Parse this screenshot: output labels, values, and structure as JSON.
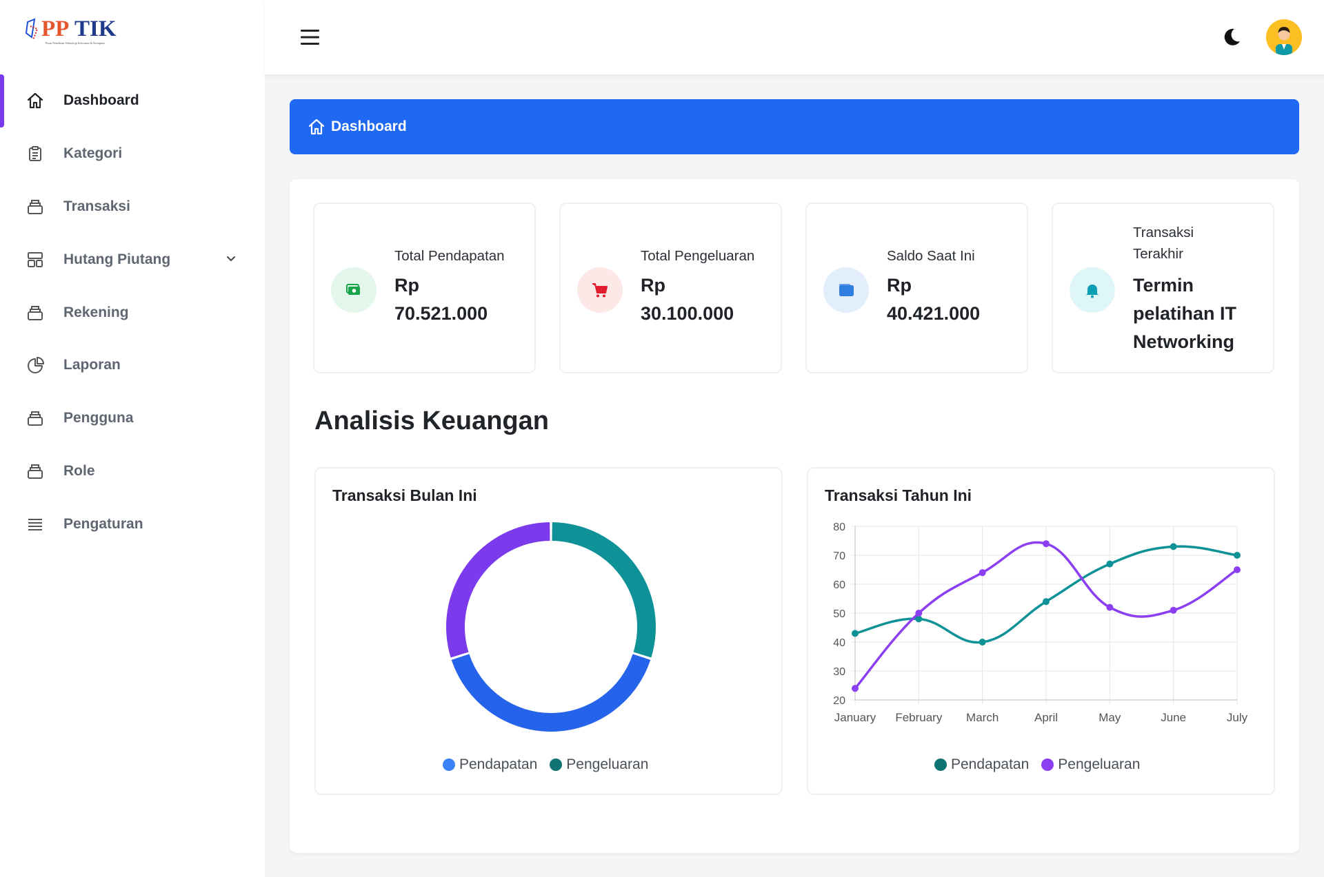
{
  "app": {
    "logo_text": "PPTIK",
    "logo_subtitle": "Pusat Penelitian Teknologi Informasi & Komputer"
  },
  "sidebar": {
    "items": [
      {
        "label": "Dashboard",
        "icon": "home-icon",
        "active": true
      },
      {
        "label": "Kategori",
        "icon": "clipboard-icon"
      },
      {
        "label": "Transaksi",
        "icon": "stack-icon"
      },
      {
        "label": "Hutang Piutang",
        "icon": "layout-icon",
        "has_submenu": true
      },
      {
        "label": "Rekening",
        "icon": "stack-icon"
      },
      {
        "label": "Laporan",
        "icon": "pie-chart-icon"
      },
      {
        "label": "Pengguna",
        "icon": "stack-icon"
      },
      {
        "label": "Role",
        "icon": "stack-icon"
      },
      {
        "label": "Pengaturan",
        "icon": "list-icon"
      }
    ]
  },
  "topbar": {
    "menu_icon": "hamburger-icon",
    "theme_icon": "moon-icon",
    "avatar_icon": "user-avatar-icon"
  },
  "breadcrumb": {
    "label": "Dashboard",
    "icon": "home-icon",
    "color": "#1f68f2"
  },
  "stats": [
    {
      "title": "Total Pendapatan",
      "value": "Rp 70.521.000",
      "icon": "money-icon",
      "icon_color": "#16a34a",
      "icon_bg": "#e3f6ec"
    },
    {
      "title": "Total Pengeluaran",
      "value": "Rp 30.100.000",
      "icon": "cart-icon",
      "icon_color": "#e11d2e",
      "icon_bg": "#fde8e8"
    },
    {
      "title": "Saldo Saat Ini",
      "value": "Rp 40.421.000",
      "icon": "wallet-icon",
      "icon_color": "#2f7de1",
      "icon_bg": "#e3eefc"
    },
    {
      "title": "Transaksi Terakhir",
      "value": "Termin pelatihan IT Networking",
      "icon": "bell-icon",
      "icon_color": "#0e9fb4",
      "icon_bg": "#dff6f9"
    }
  ],
  "section_title": "Analisis Keuangan",
  "charts": {
    "monthly_title": "Transaksi Bulan Ini",
    "yearly_title": "Transaksi Tahun Ini"
  },
  "chart_data": [
    {
      "type": "pie",
      "title": "Transaksi Bulan Ini",
      "variant": "doughnut",
      "categories": [
        "Pendapatan",
        "Pengeluaran"
      ],
      "values": [
        70.521,
        30.1
      ],
      "colors": [
        "#2563eb",
        "#0e9297"
      ],
      "segments": [
        {
          "name": "Pengeluaran",
          "value": 30.1,
          "color": "#0e9297"
        },
        {
          "name": "Pendapatan",
          "value": 40.421,
          "color": "#2563eb"
        },
        {
          "name": "Pendapatan",
          "value": 30.1,
          "color": "#7c3aed"
        }
      ],
      "legend": [
        {
          "name": "Pendapatan",
          "color": "#3b82f6"
        },
        {
          "name": "Pengeluaran",
          "color": "#0f7373"
        }
      ],
      "legend_position": "bottom"
    },
    {
      "type": "line",
      "title": "Transaksi Tahun Ini",
      "categories": [
        "January",
        "February",
        "March",
        "April",
        "May",
        "June",
        "July"
      ],
      "series": [
        {
          "name": "Pendapatan",
          "values": [
            43,
            48,
            40,
            54,
            67,
            73,
            70
          ],
          "color": "#0e9297"
        },
        {
          "name": "Pengeluaran",
          "values": [
            24,
            50,
            64,
            74,
            52,
            51,
            65
          ],
          "color": "#8b3ff0"
        }
      ],
      "ylim": [
        20,
        80
      ],
      "yticks": [
        20,
        30,
        40,
        50,
        60,
        70,
        80
      ],
      "grid": true,
      "smooth": true,
      "legend_position": "bottom"
    }
  ]
}
